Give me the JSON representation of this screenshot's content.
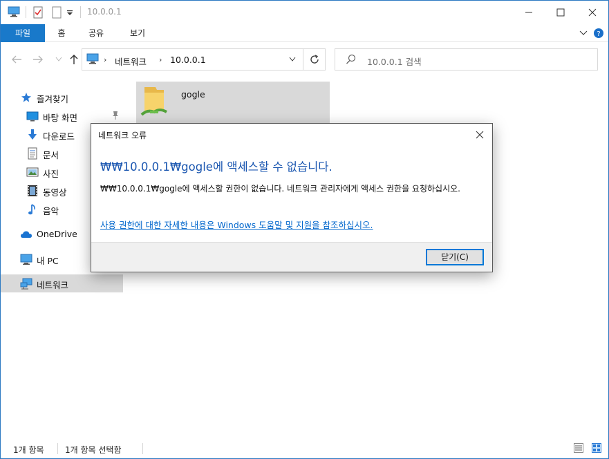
{
  "window": {
    "title": "10.0.0.1",
    "accent": "#1979ca"
  },
  "ribbon": {
    "tabs": [
      "파일",
      "홈",
      "공유",
      "보기"
    ]
  },
  "address": {
    "segments": [
      "네트워크",
      "10.0.0.1"
    ]
  },
  "search": {
    "placeholder": "10.0.0.1 검색"
  },
  "sidebar": {
    "quick_access": "즐겨찾기",
    "items": [
      {
        "label": "바탕 화면",
        "icon": "desktop-icon"
      },
      {
        "label": "다운로드",
        "icon": "download-icon"
      },
      {
        "label": "문서",
        "icon": "document-icon"
      },
      {
        "label": "사진",
        "icon": "pictures-icon"
      },
      {
        "label": "동영상",
        "icon": "video-icon"
      },
      {
        "label": "음악",
        "icon": "music-icon"
      }
    ],
    "onedrive": "OneDrive",
    "this_pc": "내 PC",
    "network": "네트워크"
  },
  "content": {
    "items": [
      {
        "name": "gogle",
        "icon": "shared-folder-icon"
      }
    ]
  },
  "status": {
    "count": "1개 항목",
    "selected": "1개 항목 선택함"
  },
  "dialog": {
    "title": "네트워크 오류",
    "heading": "₩₩10.0.0.1₩gogle에 액세스할 수 없습니다.",
    "body": "₩₩10.0.0.1₩gogle에 액세스할 권한이 없습니다. 네트워크 관리자에게 액세스 권한을 요청하십시오.",
    "link": "사용 권한에 대한 자세한 내용은 Windows 도움말 및 지원을 참조하십시오.",
    "button": "닫기(C)"
  }
}
